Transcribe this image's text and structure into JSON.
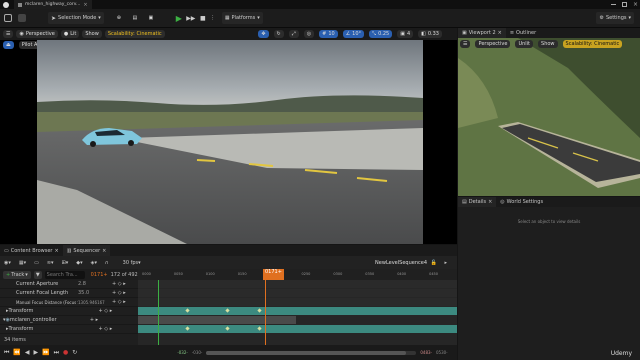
{
  "window": {
    "tab_label": "mclaren_highway_corv...",
    "close_glyph": "×"
  },
  "toolbar": {
    "selection_mode": "Selection Mode",
    "platforms": "Platforms",
    "settings": "Settings"
  },
  "viewport": {
    "perspective": "Perspective",
    "lit": "Lit",
    "show": "Show",
    "scalability": "Scalability: Cinematic",
    "pilot_actor": "Pilot Actor: CineCameraActor",
    "grid_value": "10",
    "angle_value": "10°",
    "scale_value": "0.25",
    "camera_speed": "4",
    "fov_value": "0.33"
  },
  "right_panel": {
    "viewport2_tab": "Viewport 2",
    "outliner_tab": "Outliner",
    "vp2_perspective": "Perspective",
    "vp2_unlit": "Unlit",
    "vp2_show": "Show",
    "vp2_scalability": "Scalability: Cinematic",
    "details_tab": "Details",
    "world_settings_tab": "World Settings",
    "details_hint": "Select an object to view details"
  },
  "bottom": {
    "content_browser_tab": "Content Browser",
    "sequencer_tab": "Sequencer",
    "fps": "30 fps",
    "sequence_name": "NewLevelSequence4",
    "track_button": "Track",
    "search_placeholder": "Search Tra...",
    "current_frame": "0171+",
    "frame_of": "172 of 492",
    "playhead_label": "0171+",
    "ruler_ticks": [
      "0000",
      "0050",
      "0100",
      "0150",
      "0200",
      "0250",
      "0300",
      "0350",
      "0400",
      "0450"
    ],
    "tree_items": [
      {
        "label": "Current Aperture",
        "value": "2.8"
      },
      {
        "label": "Current Focal Length",
        "value": "35.0"
      },
      {
        "label": "Manual Focus Distance (Focus S",
        "value": "1305.946167"
      },
      {
        "label": "Transform",
        "value": ""
      },
      {
        "label": "mclaren_controller",
        "value": ""
      },
      {
        "label": "Transform",
        "value": ""
      }
    ],
    "items_count": "34 items",
    "range_start": "-032-",
    "range_start2": "-030-",
    "range_end": "0483-",
    "range_end2": "0530-",
    "watermark": "Udemy"
  },
  "colors": {
    "accent_play": "#3cb043",
    "accent_scalability": "#f0c020",
    "playhead": "#e07020",
    "track_teal": "#3c8a80",
    "selection_blue": "#2a5fb0"
  }
}
